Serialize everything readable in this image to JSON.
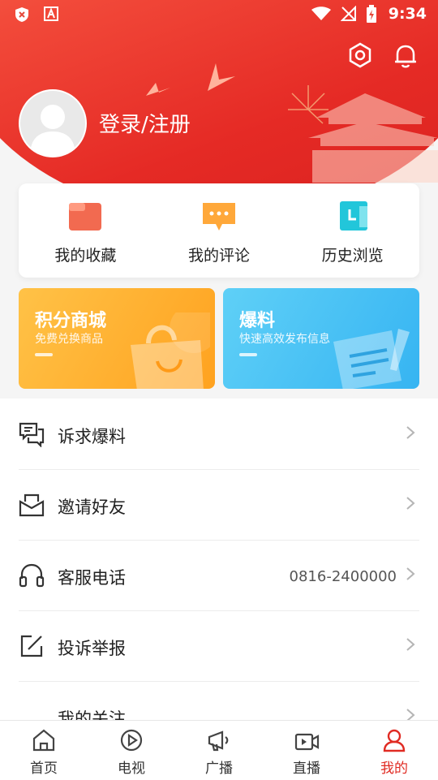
{
  "status_bar": {
    "time": "9:34"
  },
  "header": {
    "login_text": "登录/注册"
  },
  "quick_actions": [
    {
      "label": "我的收藏",
      "icon": "folder-icon"
    },
    {
      "label": "我的评论",
      "icon": "comment-icon"
    },
    {
      "label": "历史浏览",
      "icon": "history-icon"
    }
  ],
  "banners": {
    "shop": {
      "title": "积分商城",
      "subtitle": "免费兑换商品"
    },
    "news": {
      "title": "爆料",
      "subtitle": "快速高效发布信息"
    }
  },
  "menu": [
    {
      "label": "诉求爆料",
      "value": "",
      "icon": "chat-icon"
    },
    {
      "label": "邀请好友",
      "value": "",
      "icon": "mail-icon"
    },
    {
      "label": "客服电话",
      "value": "0816-2400000",
      "icon": "headset-icon"
    },
    {
      "label": "投诉举报",
      "value": "",
      "icon": "edit-icon"
    },
    {
      "label": "我的关注",
      "value": "",
      "icon": "follow-icon"
    }
  ],
  "tabs": [
    {
      "label": "首页",
      "icon": "home-icon"
    },
    {
      "label": "电视",
      "icon": "tv-icon"
    },
    {
      "label": "广播",
      "icon": "broadcast-icon"
    },
    {
      "label": "直播",
      "icon": "live-icon"
    },
    {
      "label": "我的",
      "icon": "profile-icon"
    }
  ],
  "colors": {
    "brand_red": "#e52a25",
    "active_tab": "#e02b23",
    "shop_orange": "#ffa21f",
    "news_blue": "#36b4f2"
  }
}
